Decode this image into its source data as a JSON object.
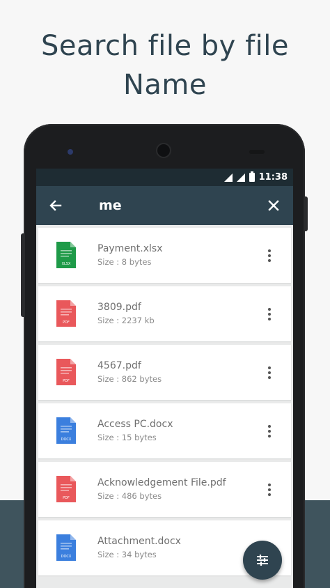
{
  "headline": {
    "line1": "Search file by file",
    "line2": "Name"
  },
  "statusbar": {
    "time": "11:38"
  },
  "appbar": {
    "search_value": "me",
    "back_icon": "arrow-left-icon",
    "close_icon": "close-icon"
  },
  "files": [
    {
      "name": "Payment.xlsx",
      "size": "Size : 8 bytes",
      "type": "xlsx",
      "badge": "XLSX",
      "color": "#1e9a48"
    },
    {
      "name": "3809.pdf",
      "size": "Size : 2237 kb",
      "type": "pdf",
      "badge": "PDF",
      "color": "#e9585b"
    },
    {
      "name": "4567.pdf",
      "size": "Size : 862 bytes",
      "type": "pdf",
      "badge": "PDF",
      "color": "#e9585b"
    },
    {
      "name": "Access PC.docx",
      "size": "Size : 15 bytes",
      "type": "docx",
      "badge": "DOCX",
      "color": "#3b7fde"
    },
    {
      "name": "Acknowledgement File.pdf",
      "size": "Size : 486 bytes",
      "type": "pdf",
      "badge": "PDF",
      "color": "#e9585b"
    },
    {
      "name": "Attachment.docx",
      "size": "Size : 34 bytes",
      "type": "docx",
      "badge": "DOCX",
      "color": "#3b7fde"
    }
  ],
  "fab": {
    "icon": "filter-sort-icon"
  },
  "colors": {
    "appbar": "#2f4450",
    "statusbar": "#1e2c33",
    "headline": "#2f4450",
    "bottom_band": "#3f545d"
  }
}
